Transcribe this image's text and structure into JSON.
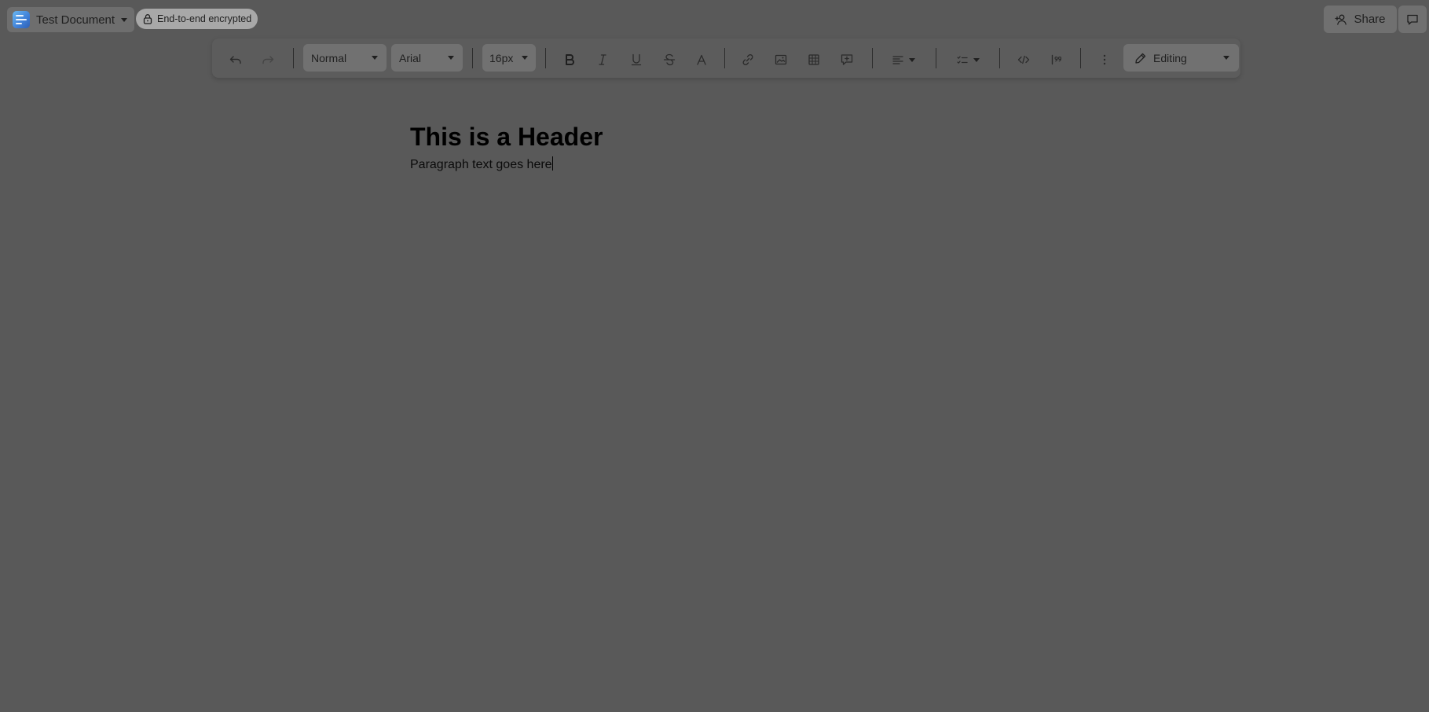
{
  "header": {
    "doc_title": "Test Document",
    "encryption_badge": "End-to-end encrypted",
    "share_label": "Share"
  },
  "toolbar": {
    "block_style": "Normal",
    "font_family": "Arial",
    "font_size": "16px",
    "mode": "Editing"
  },
  "document": {
    "heading": "This is a Header",
    "paragraph": "Paragraph text goes here"
  },
  "icons": {
    "undo": "undo-icon",
    "redo": "redo-icon",
    "bold": "bold-icon",
    "italic": "italic-icon",
    "underline": "underline-icon",
    "strikethrough": "strikethrough-icon",
    "text_color": "text-color-icon",
    "link": "link-icon",
    "image": "image-icon",
    "table": "table-icon",
    "comment": "add-comment-icon",
    "align": "align-left-icon",
    "list": "checklist-icon",
    "code": "code-icon",
    "quote": "quote-icon",
    "more": "more-vertical-icon",
    "pencil": "pencil-icon",
    "lock": "lock-icon",
    "add_user": "add-user-icon",
    "chat": "chat-icon"
  },
  "colors": {
    "background": "#595959",
    "button": "#717171",
    "badge": "#a8a8a8"
  }
}
